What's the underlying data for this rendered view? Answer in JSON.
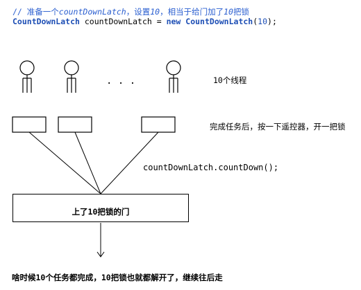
{
  "code": {
    "comment_prefix": "// 准备一个",
    "comment_class": "countDownLatch",
    "comment_mid": "，设置",
    "comment_num": "10",
    "comment_suffix": "，相当于给门加了",
    "comment_num2": "10",
    "comment_end": "把锁",
    "line2_type": "CountDownLatch",
    "line2_var": " countDownLatch = ",
    "line2_new": "new",
    "line2_sp": " ",
    "line2_ctor": "CountDownLatch",
    "line2_open": "(",
    "line2_arg": "10",
    "line2_close": ");"
  },
  "diagram": {
    "ellipsis": ". . .",
    "threads_label": "10个线程",
    "remote_label": "完成任务后，按一下遥控器，开一把锁",
    "countdown_call": "countDownLatch.countDown();",
    "door_label": "上了10把锁的门",
    "done_label": "啥时候10个任务都完成，10把锁也就都解开了，继续往后走"
  },
  "colors": {
    "keyword": "#1e4fb5",
    "comment": "#2b5fd0",
    "stroke": "#000000"
  }
}
